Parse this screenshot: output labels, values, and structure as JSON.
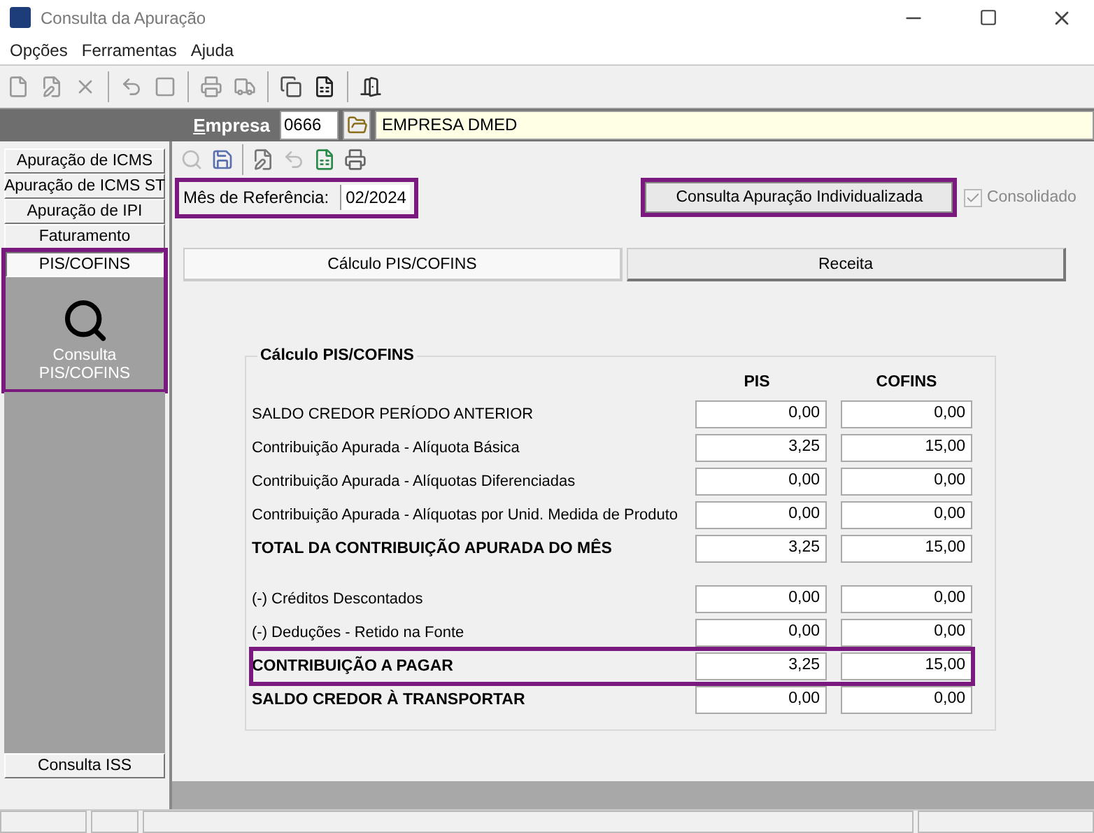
{
  "window": {
    "title": "Consulta da Apuração"
  },
  "menu": [
    "Opções",
    "Ferramentas",
    "Ajuda"
  ],
  "company": {
    "label": "Empresa",
    "code": "0666",
    "name": "EMPRESA DMED"
  },
  "sidebar": {
    "items": [
      {
        "label": "Apuração de ICMS",
        "selected": false
      },
      {
        "label": "Apuração de ICMS ST",
        "selected": false
      },
      {
        "label": "Apuração de IPI",
        "selected": false
      },
      {
        "label": "Faturamento",
        "selected": false
      },
      {
        "label": "PIS/COFINS",
        "selected": true,
        "highlighted": true
      }
    ],
    "panel_item": {
      "label": "Consulta PIS/COFINS"
    },
    "bottom_item": {
      "label": "Consulta ISS",
      "selected": false
    }
  },
  "reference_month": {
    "label": "Mês de Referência:",
    "value": "02/2024",
    "highlighted": true
  },
  "individual_button": {
    "label": "Consulta Apuração Individualizada",
    "highlighted": true
  },
  "consolidated": {
    "label": "Consolidado",
    "checked": true,
    "disabled": true
  },
  "tabs": [
    {
      "label": "Cálculo PIS/COFINS",
      "selected": true
    },
    {
      "label": "Receita",
      "selected": false
    }
  ],
  "calc": {
    "title": "Cálculo PIS/COFINS",
    "columns": [
      "PIS",
      "COFINS"
    ],
    "row_groups": [
      [
        {
          "label": "SALDO CREDOR PERÍODO ANTERIOR",
          "bold": false,
          "pis": "0,00",
          "cofins": "0,00",
          "highlighted": false
        },
        {
          "label": "Contribuição Apurada - Alíquota Básica",
          "bold": false,
          "pis": "3,25",
          "cofins": "15,00",
          "highlighted": false
        },
        {
          "label": "Contribuição Apurada - Alíquotas Diferenciadas",
          "bold": false,
          "pis": "0,00",
          "cofins": "0,00",
          "highlighted": false
        },
        {
          "label": "Contribuição Apurada - Alíquotas por Unid. Medida de Produto",
          "bold": false,
          "pis": "0,00",
          "cofins": "0,00",
          "highlighted": false
        },
        {
          "label": "TOTAL DA CONTRIBUIÇÃO APURADA DO MÊS",
          "bold": true,
          "pis": "3,25",
          "cofins": "15,00",
          "highlighted": false
        }
      ],
      [
        {
          "label": "(-) Créditos Descontados",
          "bold": false,
          "pis": "0,00",
          "cofins": "0,00",
          "highlighted": false
        },
        {
          "label": "(-) Deduções - Retido na Fonte",
          "bold": false,
          "pis": "0,00",
          "cofins": "0,00",
          "highlighted": false
        },
        {
          "label": "CONTRIBUIÇÃO A PAGAR",
          "bold": true,
          "pis": "3,25",
          "cofins": "15,00",
          "highlighted": true
        },
        {
          "label": "SALDO CREDOR À TRANSPORTAR",
          "bold": true,
          "pis": "0,00",
          "cofins": "0,00",
          "highlighted": false
        }
      ]
    ]
  }
}
